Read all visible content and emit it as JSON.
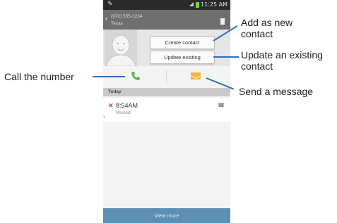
{
  "status_bar": {
    "time": "11:25 AM"
  },
  "header": {
    "phone_number": "(972) 555-1234",
    "location": "Texas"
  },
  "contact_actions": {
    "create_contact": "Create contact",
    "update_existing": "Update existing"
  },
  "call_log": {
    "section_title": "Today",
    "entries": [
      {
        "time": "8:54AM",
        "status": "Missed"
      }
    ]
  },
  "footer": {
    "view_more": "View more"
  },
  "callouts": {
    "add_new": "Add as new contact",
    "update_existing": "Update an existing contact",
    "call_number": "Call the number",
    "send_message": "Send a message"
  },
  "colors": {
    "accent_blue": "#2f6fb6",
    "call_green": "#5cb84c",
    "message_orange": "#f3b43a",
    "missed_red": "#d63a3a"
  }
}
